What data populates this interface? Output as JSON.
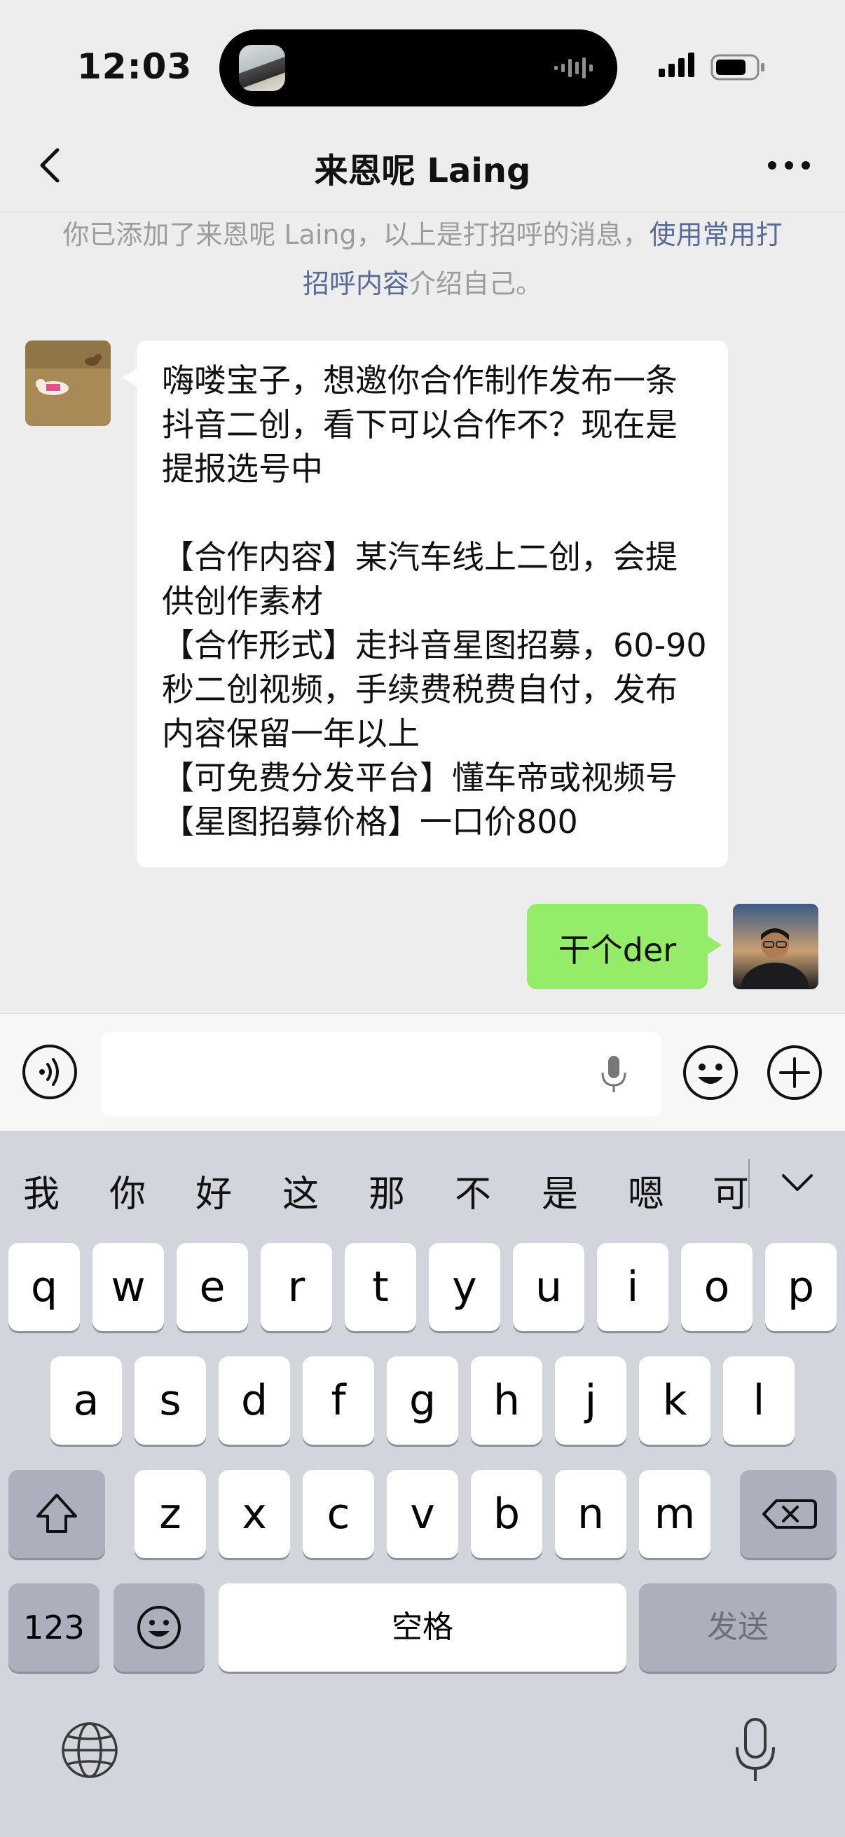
{
  "status_bar": {
    "time": "12:03"
  },
  "nav": {
    "title": "来恩呢 Laing",
    "back_icon": "chevron-left-icon",
    "more_icon": "ellipsis-icon"
  },
  "system_message": {
    "text_before": "你已添加了来恩呢 Laing，以上是打招呼的消息，",
    "link_text": "使用常用打招呼内容",
    "text_after": "介绍自己。"
  },
  "messages": [
    {
      "direction": "in",
      "text": "嗨喽宝子，想邀你合作制作发布一条抖音二创，看下可以合作不？现在是提报选号中\n\n【合作内容】某汽车线上二创，会提供创作素材\n【合作形式】走抖音星图招募，60-90秒二创视频，手续费税费自付，发布内容保留一年以上\n【可免费分发平台】懂车帝或视频号\n【星图招募价格】一口价800"
    },
    {
      "direction": "out",
      "text": "干个der"
    }
  ],
  "input_bar": {
    "value": "",
    "placeholder": ""
  },
  "keyboard": {
    "candidates": [
      "我",
      "你",
      "好",
      "这",
      "那",
      "不",
      "是",
      "嗯",
      "可"
    ],
    "row1": [
      "q",
      "w",
      "e",
      "r",
      "t",
      "y",
      "u",
      "i",
      "o",
      "p"
    ],
    "row2": [
      "a",
      "s",
      "d",
      "f",
      "g",
      "h",
      "j",
      "k",
      "l"
    ],
    "row3": [
      "z",
      "x",
      "c",
      "v",
      "b",
      "n",
      "m"
    ],
    "numbers_key": "123",
    "space_key": "空格",
    "send_key": "发送"
  },
  "colors": {
    "background": "#ededed",
    "outgoing_bubble": "#95ec69",
    "link": "#576b95",
    "keyboard_bg": "#d2d5db"
  }
}
